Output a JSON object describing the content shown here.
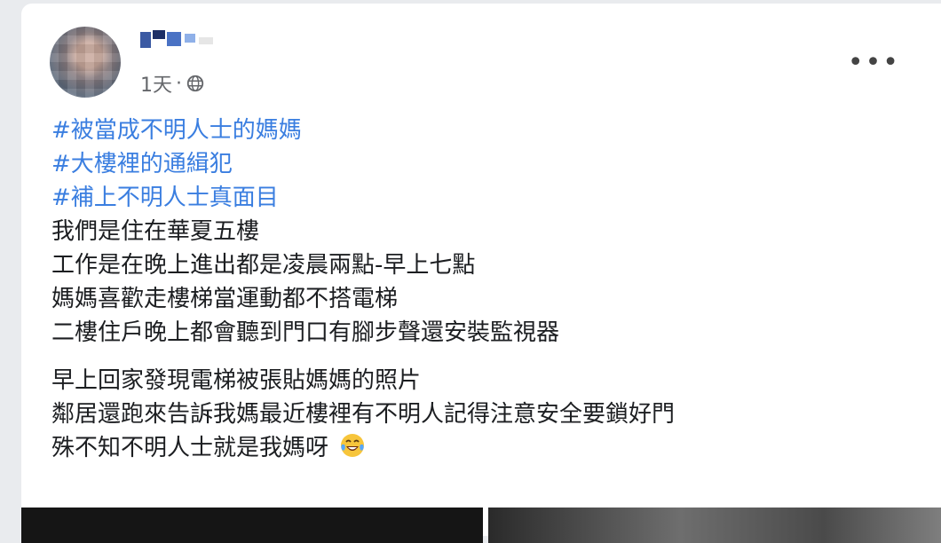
{
  "post": {
    "time": "1天",
    "separator": "·",
    "privacy_icon": "globe-icon",
    "more_label": "•••",
    "hashtags": [
      "#被當成不明人士的媽媽",
      "#大樓裡的通緝犯",
      "#補上不明人士真面目"
    ],
    "paragraph1": [
      "我們是住在華夏五樓",
      "工作是在晚上進出都是凌晨兩點-早上七點",
      "媽媽喜歡走樓梯當運動都不搭電梯",
      "二樓住戶晚上都會聽到門口有腳步聲還安裝監視器"
    ],
    "paragraph2": [
      "早上回家發現電梯被張貼媽媽的照片",
      "鄰居還跑來告訴我媽最近樓裡有不明人記得注意安全要鎖好門",
      "殊不知不明人士就是我媽呀"
    ],
    "trailing_emoji": "laughing-tears-emoji"
  },
  "colors": {
    "hashtag": "#3a7ee0",
    "text": "#1c1e21",
    "meta": "#65676b",
    "background": "#e9ebee"
  }
}
